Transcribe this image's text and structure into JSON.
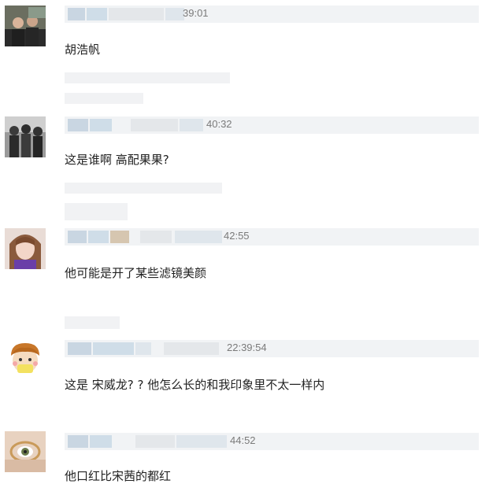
{
  "comments": [
    {
      "time": "39:01",
      "text": "胡浩帆"
    },
    {
      "time": "40:32",
      "text": "这是谁啊 高配果果?"
    },
    {
      "time": "42:55",
      "text": "他可能是开了某些滤镜美颜"
    },
    {
      "time": "22:39:54",
      "text": "这是 宋威龙? ? 他怎么长的和我印象里不太一样内"
    },
    {
      "time": "44:52",
      "text": "他口红比宋茜的都红"
    }
  ],
  "avatars": [
    "photo-avatar-two-people",
    "photo-avatar-group",
    "photo-avatar-girl",
    "cartoon-avatar-boy",
    "photo-avatar-eye-glasses"
  ]
}
